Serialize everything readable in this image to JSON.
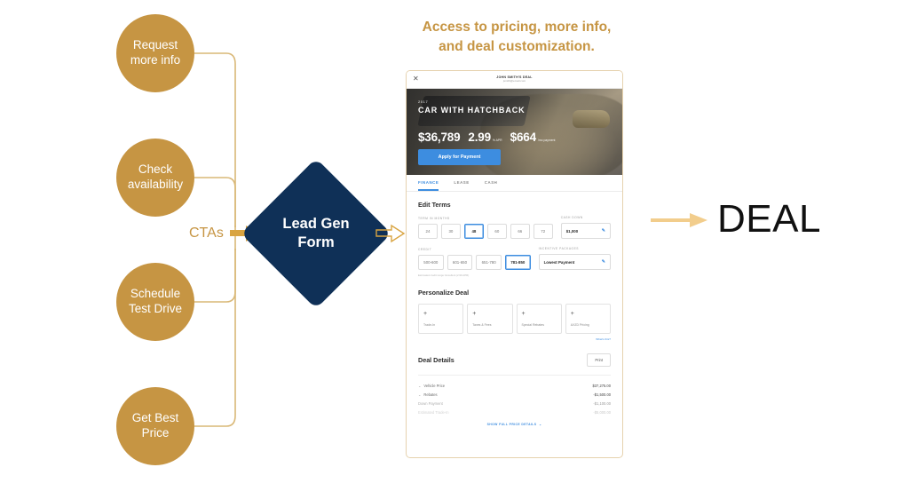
{
  "heading": "Access to pricing, more info,\nand deal customization.",
  "ctas_label": "CTAs",
  "circles": [
    {
      "label": "Request\nmore info"
    },
    {
      "label": "Check\navailability"
    },
    {
      "label": "Schedule\nTest Drive"
    },
    {
      "label": "Get Best\nPrice"
    }
  ],
  "diamond": {
    "label": "Lead Gen\nForm"
  },
  "outcome": {
    "label": "DEAL"
  },
  "colors": {
    "gold": "#c69543",
    "gold_light": "#f0cd8a",
    "navy": "#0f3057",
    "blue": "#3d8de0"
  },
  "phone": {
    "topbar": {
      "close_icon": "close-icon",
      "owner_name": "JOHN SMITH'S DEAL",
      "owner_email": "jsmith@email.com"
    },
    "hero": {
      "year": "2017",
      "model": "CAR WITH HATCHBACK",
      "price": "$36,789",
      "apr": "2.99",
      "apr_unit": "% APR",
      "payment": "$664",
      "payment_unit": "/mo payment",
      "cta_button": "Apply for Payment"
    },
    "tabs": [
      {
        "label": "FINANCE",
        "active": true
      },
      {
        "label": "LEASE",
        "active": false
      },
      {
        "label": "CASH",
        "active": false
      }
    ],
    "edit_terms": {
      "title": "Edit Terms",
      "term_label": "TERM IN MONTHS",
      "terms": [
        "24",
        "30",
        "48",
        "60",
        "66",
        "72"
      ],
      "term_selected": "48",
      "cash_down_label": "CASH DOWN",
      "cash_down_value": "$1,000",
      "cash_down_icon": "pencil-icon",
      "credit_label": "CREDIT",
      "credit_ranges": [
        "500-600",
        "601-650",
        "651-780",
        "781-850"
      ],
      "credit_selected": "781-850",
      "incentive_label": "INCENTIVE PACKAGES",
      "incentive_value": "Lowest Payment",
      "incentive_icon": "pencil-icon",
      "note": "Estimated credit range: Excellent (2.99 APR)"
    },
    "personalize": {
      "title": "Personalize Deal",
      "cards": [
        {
          "icon": "plus-icon",
          "label": "Trade-In"
        },
        {
          "icon": "plus-icon",
          "label": "Taxes & Fees"
        },
        {
          "icon": "plus-icon",
          "label": "Special Rebates"
        },
        {
          "icon": "plus-icon",
          "label": "AXZD Pricing"
        }
      ],
      "link": "What's this?"
    },
    "deal_details": {
      "title": "Deal Details",
      "print_button": "Print",
      "rows": [
        {
          "label": "Vehicle Price",
          "value": "$37,275.00",
          "chev": "⌄"
        },
        {
          "label": "Rebates",
          "value": "-$1,500.00",
          "chev": "⌄"
        },
        {
          "label": "Down Payment",
          "value": "-$1,100.00",
          "chev": ""
        },
        {
          "label": "Estimated Trade-In",
          "value": "-$5,000.00",
          "chev": ""
        }
      ],
      "show_full": "SHOW FULL PRICE DETAILS"
    }
  }
}
